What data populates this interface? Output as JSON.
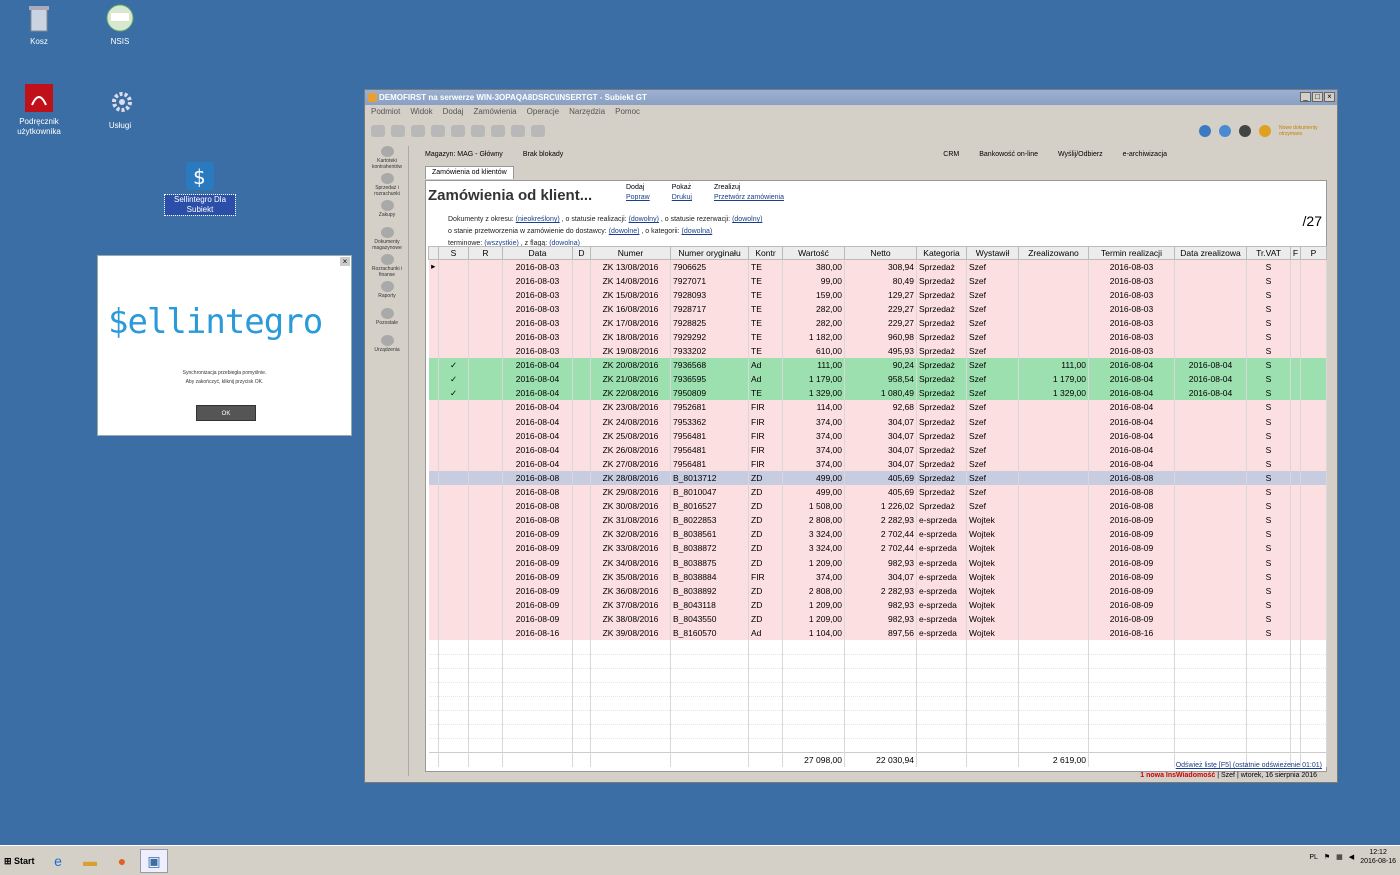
{
  "desktop": {
    "icons": [
      {
        "label": "Kosz",
        "icon": "recycle-bin-icon"
      },
      {
        "label": "NSIS",
        "icon": "nsis-icon"
      },
      {
        "label": "Podręcznik użytkownika",
        "icon": "pdf-icon"
      },
      {
        "label": "Usługi",
        "icon": "gear-icon"
      },
      {
        "label": "Sellintegro Dla Subiekt",
        "icon": "sellintegro-icon"
      }
    ]
  },
  "popup": {
    "logo": "$ellintegro",
    "message_line1": "Synchronizacja przebiegła pomyślnie.",
    "message_line2": "Aby zakończyć, kliknij przycisk OK.",
    "ok_label": "OK"
  },
  "window": {
    "title": "DEMOFIRST na serwerze WIN-3OPAQA8DSRC\\INSERTGT - Subiekt GT",
    "menu": [
      "Podmiot",
      "Widok",
      "Dodaj",
      "Zamówienia",
      "Operacje",
      "Narzędzia",
      "Pomoc"
    ],
    "brand_badge": "Nowe dokumenty otrzymano",
    "info": {
      "magazyn": "Magazyn: MAG - Główny",
      "blokady": "Brak blokady",
      "crm": "CRM",
      "bank": "Bankowość on-line",
      "send": "Wyślij/Odbierz",
      "archive": "e-archiwizacja"
    },
    "sidebar": [
      "Kartoteki kontrahentów",
      "Sprzedaż i rozrachunki",
      "Zakupy",
      "Dokumenty magazynowe",
      "Rozrachunki i finanse",
      "Raporty",
      "Pozostałe",
      "Urządzenia"
    ],
    "tab_label": "Zamówienia od klientów",
    "heading": "Zamówienia od klient...",
    "actions": {
      "dodaj": "Dodaj",
      "popraw": "Popraw",
      "pokaz": "Pokaż",
      "drukuj": "Drukuj",
      "zrealizuj": "Zrealizuj",
      "przetworz": "Przetwórz zamówienia"
    },
    "filters": {
      "line1_label": "Dokumenty z okresu:",
      "line1_value": "(nieokreślony)",
      "line1_mid": ", o statusie realizacji:",
      "line1_value2": "(dowolny)",
      "line1_mid2": ", o statusie rezerwacji:",
      "line1_value3": "(dowolny)",
      "line2_label": "o stanie przetworzenia w zamówienie do dostawcy:",
      "line2_value": "(dowolne)",
      "line2_mid": ", o kategorii:",
      "line2_value2": "(dowolna)",
      "line3_label": "terminowe:",
      "line3_value": "(wszystkie)",
      "line3_mid": ", z flagą:",
      "line3_value2": "(dowolna)"
    },
    "count": "/27",
    "columns": [
      "",
      "S",
      "R",
      "Data",
      "D",
      "Numer",
      "Numer oryginału",
      "Kontr",
      "Wartość",
      "Netto",
      "Kategoria",
      "Wystawił",
      "Zrealizowano",
      "Termin realizacji",
      "Data zrealizowa",
      "Tr.VAT",
      "F",
      "P"
    ],
    "rows": [
      {
        "st": "pink",
        "mk": "▸",
        "s": "",
        "data": "2016-08-03",
        "nr": "ZK 13/08/2016",
        "orig": "7906625",
        "k": "TE",
        "w": "380,00",
        "n": "308,94",
        "kat": "Sprzedaż",
        "wys": "Szef",
        "zr": "",
        "term": "2016-08-03",
        "dz": "",
        "vat": "S"
      },
      {
        "st": "pink",
        "mk": "",
        "s": "",
        "data": "2016-08-03",
        "nr": "ZK 14/08/2016",
        "orig": "7927071",
        "k": "TE",
        "w": "99,00",
        "n": "80,49",
        "kat": "Sprzedaż",
        "wys": "Szef",
        "zr": "",
        "term": "2016-08-03",
        "dz": "",
        "vat": "S"
      },
      {
        "st": "pink",
        "mk": "",
        "s": "",
        "data": "2016-08-03",
        "nr": "ZK 15/08/2016",
        "orig": "7928093",
        "k": "TE",
        "w": "159,00",
        "n": "129,27",
        "kat": "Sprzedaż",
        "wys": "Szef",
        "zr": "",
        "term": "2016-08-03",
        "dz": "",
        "vat": "S"
      },
      {
        "st": "pink",
        "mk": "",
        "s": "",
        "data": "2016-08-03",
        "nr": "ZK 16/08/2016",
        "orig": "7928717",
        "k": "TE",
        "w": "282,00",
        "n": "229,27",
        "kat": "Sprzedaż",
        "wys": "Szef",
        "zr": "",
        "term": "2016-08-03",
        "dz": "",
        "vat": "S"
      },
      {
        "st": "pink",
        "mk": "",
        "s": "",
        "data": "2016-08-03",
        "nr": "ZK 17/08/2016",
        "orig": "7928825",
        "k": "TE",
        "w": "282,00",
        "n": "229,27",
        "kat": "Sprzedaż",
        "wys": "Szef",
        "zr": "",
        "term": "2016-08-03",
        "dz": "",
        "vat": "S"
      },
      {
        "st": "pink",
        "mk": "",
        "s": "",
        "data": "2016-08-03",
        "nr": "ZK 18/08/2016",
        "orig": "7929292",
        "k": "TE",
        "w": "1 182,00",
        "n": "960,98",
        "kat": "Sprzedaż",
        "wys": "Szef",
        "zr": "",
        "term": "2016-08-03",
        "dz": "",
        "vat": "S"
      },
      {
        "st": "pink",
        "mk": "",
        "s": "",
        "data": "2016-08-03",
        "nr": "ZK 19/08/2016",
        "orig": "7933202",
        "k": "TE",
        "w": "610,00",
        "n": "495,93",
        "kat": "Sprzedaż",
        "wys": "Szef",
        "zr": "",
        "term": "2016-08-03",
        "dz": "",
        "vat": "S"
      },
      {
        "st": "green",
        "mk": "",
        "s": "✓",
        "data": "2016-08-04",
        "nr": "ZK 20/08/2016",
        "orig": "7936568",
        "k": "Ad",
        "w": "111,00",
        "n": "90,24",
        "kat": "Sprzedaż",
        "wys": "Szef",
        "zr": "111,00",
        "term": "2016-08-04",
        "dz": "2016-08-04",
        "vat": "S"
      },
      {
        "st": "green",
        "mk": "",
        "s": "✓",
        "data": "2016-08-04",
        "nr": "ZK 21/08/2016",
        "orig": "7936595",
        "k": "Ad",
        "w": "1 179,00",
        "n": "958,54",
        "kat": "Sprzedaż",
        "wys": "Szef",
        "zr": "1 179,00",
        "term": "2016-08-04",
        "dz": "2016-08-04",
        "vat": "S"
      },
      {
        "st": "green",
        "mk": "",
        "s": "✓",
        "data": "2016-08-04",
        "nr": "ZK 22/08/2016",
        "orig": "7950809",
        "k": "TE",
        "w": "1 329,00",
        "n": "1 080,49",
        "kat": "Sprzedaż",
        "wys": "Szef",
        "zr": "1 329,00",
        "term": "2016-08-04",
        "dz": "2016-08-04",
        "vat": "S"
      },
      {
        "st": "pink",
        "mk": "",
        "s": "",
        "data": "2016-08-04",
        "nr": "ZK 23/08/2016",
        "orig": "7952681",
        "k": "FIR",
        "w": "114,00",
        "n": "92,68",
        "kat": "Sprzedaż",
        "wys": "Szef",
        "zr": "",
        "term": "2016-08-04",
        "dz": "",
        "vat": "S"
      },
      {
        "st": "pink",
        "mk": "",
        "s": "",
        "data": "2016-08-04",
        "nr": "ZK 24/08/2016",
        "orig": "7953362",
        "k": "FIR",
        "w": "374,00",
        "n": "304,07",
        "kat": "Sprzedaż",
        "wys": "Szef",
        "zr": "",
        "term": "2016-08-04",
        "dz": "",
        "vat": "S"
      },
      {
        "st": "pink",
        "mk": "",
        "s": "",
        "data": "2016-08-04",
        "nr": "ZK 25/08/2016",
        "orig": "7956481",
        "k": "FIR",
        "w": "374,00",
        "n": "304,07",
        "kat": "Sprzedaż",
        "wys": "Szef",
        "zr": "",
        "term": "2016-08-04",
        "dz": "",
        "vat": "S"
      },
      {
        "st": "pink",
        "mk": "",
        "s": "",
        "data": "2016-08-04",
        "nr": "ZK 26/08/2016",
        "orig": "7956481",
        "k": "FIR",
        "w": "374,00",
        "n": "304,07",
        "kat": "Sprzedaż",
        "wys": "Szef",
        "zr": "",
        "term": "2016-08-04",
        "dz": "",
        "vat": "S"
      },
      {
        "st": "pink",
        "mk": "",
        "s": "",
        "data": "2016-08-04",
        "nr": "ZK 27/08/2016",
        "orig": "7956481",
        "k": "FIR",
        "w": "374,00",
        "n": "304,07",
        "kat": "Sprzedaż",
        "wys": "Szef",
        "zr": "",
        "term": "2016-08-04",
        "dz": "",
        "vat": "S"
      },
      {
        "st": "blue",
        "mk": "",
        "s": "",
        "data": "2016-08-08",
        "nr": "ZK 28/08/2016",
        "orig": "B_8013712",
        "k": "ZD",
        "w": "499,00",
        "n": "405,69",
        "kat": "Sprzedaż",
        "wys": "Szef",
        "zr": "",
        "term": "2016-08-08",
        "dz": "",
        "vat": "S"
      },
      {
        "st": "pink",
        "mk": "",
        "s": "",
        "data": "2016-08-08",
        "nr": "ZK 29/08/2016",
        "orig": "B_8010047",
        "k": "ZD",
        "w": "499,00",
        "n": "405,69",
        "kat": "Sprzedaż",
        "wys": "Szef",
        "zr": "",
        "term": "2016-08-08",
        "dz": "",
        "vat": "S"
      },
      {
        "st": "pink",
        "mk": "",
        "s": "",
        "data": "2016-08-08",
        "nr": "ZK 30/08/2016",
        "orig": "B_8016527",
        "k": "ZD",
        "w": "1 508,00",
        "n": "1 226,02",
        "kat": "Sprzedaż",
        "wys": "Szef",
        "zr": "",
        "term": "2016-08-08",
        "dz": "",
        "vat": "S"
      },
      {
        "st": "pink",
        "mk": "",
        "s": "",
        "data": "2016-08-08",
        "nr": "ZK 31/08/2016",
        "orig": "B_8022853",
        "k": "ZD",
        "w": "2 808,00",
        "n": "2 282,93",
        "kat": "e-sprzeda",
        "wys": "Wojtek",
        "zr": "",
        "term": "2016-08-09",
        "dz": "",
        "vat": "S"
      },
      {
        "st": "pink",
        "mk": "",
        "s": "",
        "data": "2016-08-09",
        "nr": "ZK 32/08/2016",
        "orig": "B_8038561",
        "k": "ZD",
        "w": "3 324,00",
        "n": "2 702,44",
        "kat": "e-sprzeda",
        "wys": "Wojtek",
        "zr": "",
        "term": "2016-08-09",
        "dz": "",
        "vat": "S"
      },
      {
        "st": "pink",
        "mk": "",
        "s": "",
        "data": "2016-08-09",
        "nr": "ZK 33/08/2016",
        "orig": "B_8038872",
        "k": "ZD",
        "w": "3 324,00",
        "n": "2 702,44",
        "kat": "e-sprzeda",
        "wys": "Wojtek",
        "zr": "",
        "term": "2016-08-09",
        "dz": "",
        "vat": "S"
      },
      {
        "st": "pink",
        "mk": "",
        "s": "",
        "data": "2016-08-09",
        "nr": "ZK 34/08/2016",
        "orig": "B_8038875",
        "k": "ZD",
        "w": "1 209,00",
        "n": "982,93",
        "kat": "e-sprzeda",
        "wys": "Wojtek",
        "zr": "",
        "term": "2016-08-09",
        "dz": "",
        "vat": "S"
      },
      {
        "st": "pink",
        "mk": "",
        "s": "",
        "data": "2016-08-09",
        "nr": "ZK 35/08/2016",
        "orig": "B_8038884",
        "k": "FIR",
        "w": "374,00",
        "n": "304,07",
        "kat": "e-sprzeda",
        "wys": "Wojtek",
        "zr": "",
        "term": "2016-08-09",
        "dz": "",
        "vat": "S"
      },
      {
        "st": "pink",
        "mk": "",
        "s": "",
        "data": "2016-08-09",
        "nr": "ZK 36/08/2016",
        "orig": "B_8038892",
        "k": "ZD",
        "w": "2 808,00",
        "n": "2 282,93",
        "kat": "e-sprzeda",
        "wys": "Wojtek",
        "zr": "",
        "term": "2016-08-09",
        "dz": "",
        "vat": "S"
      },
      {
        "st": "pink",
        "mk": "",
        "s": "",
        "data": "2016-08-09",
        "nr": "ZK 37/08/2016",
        "orig": "B_8043118",
        "k": "ZD",
        "w": "1 209,00",
        "n": "982,93",
        "kat": "e-sprzeda",
        "wys": "Wojtek",
        "zr": "",
        "term": "2016-08-09",
        "dz": "",
        "vat": "S"
      },
      {
        "st": "pink",
        "mk": "",
        "s": "",
        "data": "2016-08-09",
        "nr": "ZK 38/08/2016",
        "orig": "B_8043550",
        "k": "ZD",
        "w": "1 209,00",
        "n": "982,93",
        "kat": "e-sprzeda",
        "wys": "Wojtek",
        "zr": "",
        "term": "2016-08-09",
        "dz": "",
        "vat": "S"
      },
      {
        "st": "pink",
        "mk": "",
        "s": "",
        "data": "2016-08-16",
        "nr": "ZK 39/08/2016",
        "orig": "B_8160570",
        "k": "Ad",
        "w": "1 104,00",
        "n": "897,56",
        "kat": "e-sprzeda",
        "wys": "Wojtek",
        "zr": "",
        "term": "2016-08-16",
        "dz": "",
        "vat": "S"
      }
    ],
    "totals": {
      "wartosc": "27 098,00",
      "netto": "22 030,94",
      "zrealizowano": "2 619,00"
    },
    "refresh_link": "Odśwież listę [F5] (ostatnie odświeżenie 01:01)",
    "status": {
      "alert": "1 nowa InsWiadomość",
      "user": "Szef",
      "date": "wtorek, 16 sierpnia 2016"
    }
  },
  "taskbar": {
    "start": "Start",
    "lang": "PL",
    "time": "12:12",
    "date": "2016-08-16"
  }
}
